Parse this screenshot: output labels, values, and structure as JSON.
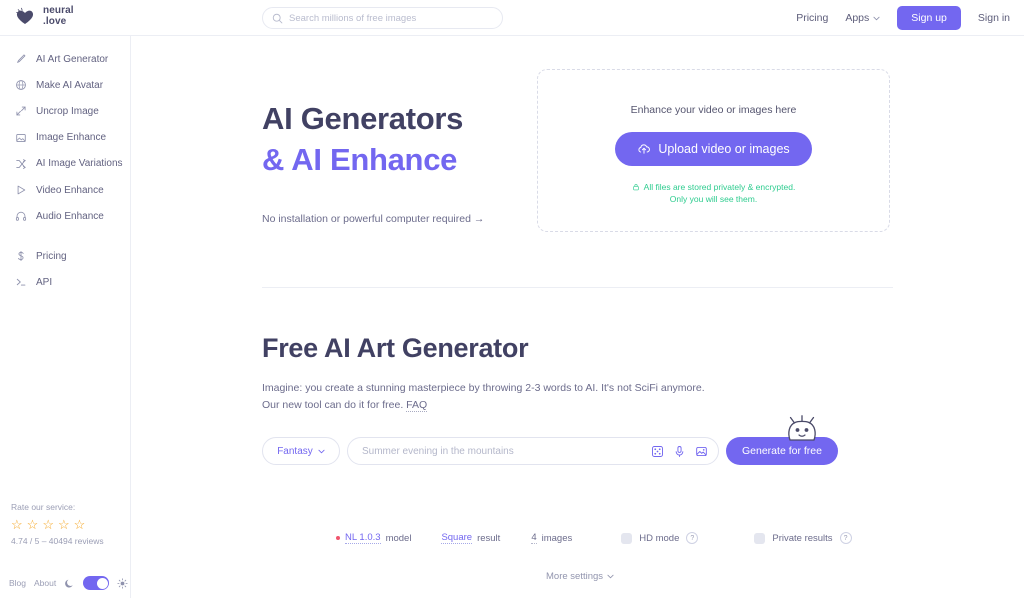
{
  "brand": {
    "name_line1": "neural",
    "name_line2": ".love"
  },
  "search": {
    "placeholder": "Search millions of free images"
  },
  "header": {
    "pricing": "Pricing",
    "apps": "Apps",
    "signup": "Sign up",
    "signin": "Sign in"
  },
  "sidebar": {
    "tools": [
      {
        "label": "AI Art Generator",
        "icon": "brush-icon"
      },
      {
        "label": "Make AI Avatar",
        "icon": "globe-icon"
      },
      {
        "label": "Uncrop Image",
        "icon": "expand-icon"
      },
      {
        "label": "Image Enhance",
        "icon": "image-icon"
      },
      {
        "label": "AI Image Variations",
        "icon": "shuffle-icon"
      },
      {
        "label": "Video Enhance",
        "icon": "play-icon"
      },
      {
        "label": "Audio Enhance",
        "icon": "headphones-icon"
      }
    ],
    "secondary": [
      {
        "label": "Pricing",
        "icon": "dollar-icon"
      },
      {
        "label": "API",
        "icon": "terminal-icon"
      }
    ],
    "rating": {
      "title": "Rate our service:",
      "stars": 5,
      "summary": "4.74 / 5 – 40494 reviews"
    },
    "footer": {
      "blog": "Blog",
      "about": "About"
    }
  },
  "hero": {
    "title_line1": "AI Generators",
    "title_line2": "& AI Enhance",
    "subtitle": "No installation or powerful computer required →"
  },
  "upload": {
    "heading": "Enhance your video or images here",
    "button": "Upload video or images",
    "note_line1": "All files are stored privately & encrypted.",
    "note_line2": "Only you will see them."
  },
  "generator": {
    "title": "Free AI Art Generator",
    "body_line1": "Imagine: you create a stunning masterpiece by throwing 2-3 words to AI. It's not SciFi anymore.",
    "body_line2_pre": "Our new tool can do it for free.",
    "faq": "FAQ",
    "style": "Fantasy",
    "prompt_placeholder": "Summer evening in the mountains",
    "generate": "Generate for free",
    "options": {
      "model_name": "NL 1.0.3",
      "model_suffix": "model",
      "result_value": "Square",
      "result_suffix": "result",
      "count_value": "4",
      "count_suffix": "images",
      "hd_mode": "HD mode",
      "private_results": "Private results",
      "help": "?"
    },
    "more_settings": "More settings"
  },
  "colors": {
    "accent": "#7367f0",
    "green": "#2ecc8f",
    "star": "#f5a623",
    "red_dot": "#f0556d"
  }
}
